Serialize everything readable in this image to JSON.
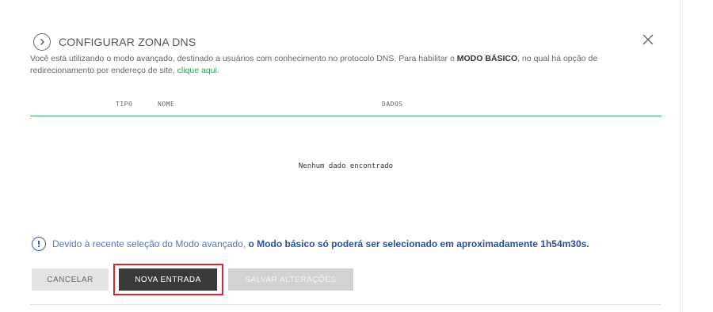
{
  "header": {
    "title": "CONFIGURAR ZONA DNS"
  },
  "description": {
    "text_before": "Você está utilizando o modo avançado, destinado a usuários com conhecimento no protocolo DNS. Para habilitar o ",
    "bold": "MODO BÁSICO",
    "text_after": ", no qual há opção de redirecionamento por endereço de site, ",
    "link": "clique aqui."
  },
  "table": {
    "columns": [
      "TIPO",
      "NOME",
      "DADOS"
    ],
    "empty_message": "Nenhum dado encontrado"
  },
  "notice": {
    "text_before": "Devido à recente seleção do Modo avançado, ",
    "strong": "o Modo básico só poderá ser selecionado em aproximadamente 1h54m30s."
  },
  "buttons": {
    "cancel": "CANCELAR",
    "new_entry": "NOVA ENTRADA",
    "save": "SALVAR ALTERAÇÕES"
  },
  "icons": {
    "header": "chevron-right-circle-icon",
    "close": "close-icon",
    "notice": "info-icon"
  },
  "colors": {
    "accent_green": "#3fa65a",
    "notice_blue": "#2b4f9a",
    "highlight_red": "#d9262e"
  }
}
